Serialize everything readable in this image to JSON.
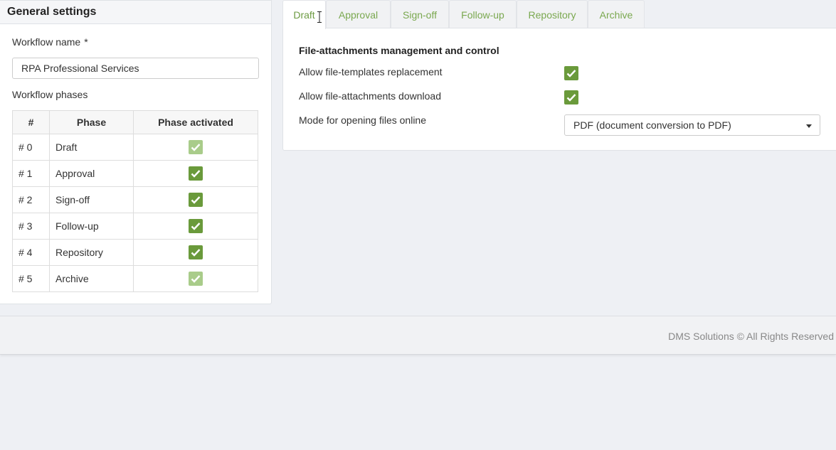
{
  "colors": {
    "accent": "#6d9b43",
    "check": "#6a9a3b",
    "check_disabled": "#a9cc8a"
  },
  "general": {
    "title": "General settings",
    "workflow_name_label": "Workflow name",
    "required_mark": "*",
    "workflow_name_value": "RPA Professional Services",
    "phases_label": "Workflow phases",
    "table": {
      "headers": [
        "#",
        "Phase",
        "Phase activated"
      ],
      "rows": [
        {
          "num": "# 0",
          "phase": "Draft",
          "activated": true,
          "enabled": false
        },
        {
          "num": "# 1",
          "phase": "Approval",
          "activated": true,
          "enabled": true
        },
        {
          "num": "# 2",
          "phase": "Sign-off",
          "activated": true,
          "enabled": true
        },
        {
          "num": "# 3",
          "phase": "Follow-up",
          "activated": true,
          "enabled": true
        },
        {
          "num": "# 4",
          "phase": "Repository",
          "activated": true,
          "enabled": true
        },
        {
          "num": "# 5",
          "phase": "Archive",
          "activated": true,
          "enabled": false
        }
      ]
    }
  },
  "tabs": [
    "Draft",
    "Approval",
    "Sign-off",
    "Follow-up",
    "Repository",
    "Archive"
  ],
  "active_tab": "Draft",
  "draft": {
    "section_title": "File-attachments management and control",
    "options": [
      {
        "label": "Allow file-templates replacement",
        "checked": true
      },
      {
        "label": "Allow file-attachments download",
        "checked": true
      }
    ],
    "mode_label": "Mode for opening files online",
    "mode_value": "PDF (document conversion to PDF)"
  },
  "footer": {
    "text": "DMS Solutions © All Rights Reserved"
  }
}
